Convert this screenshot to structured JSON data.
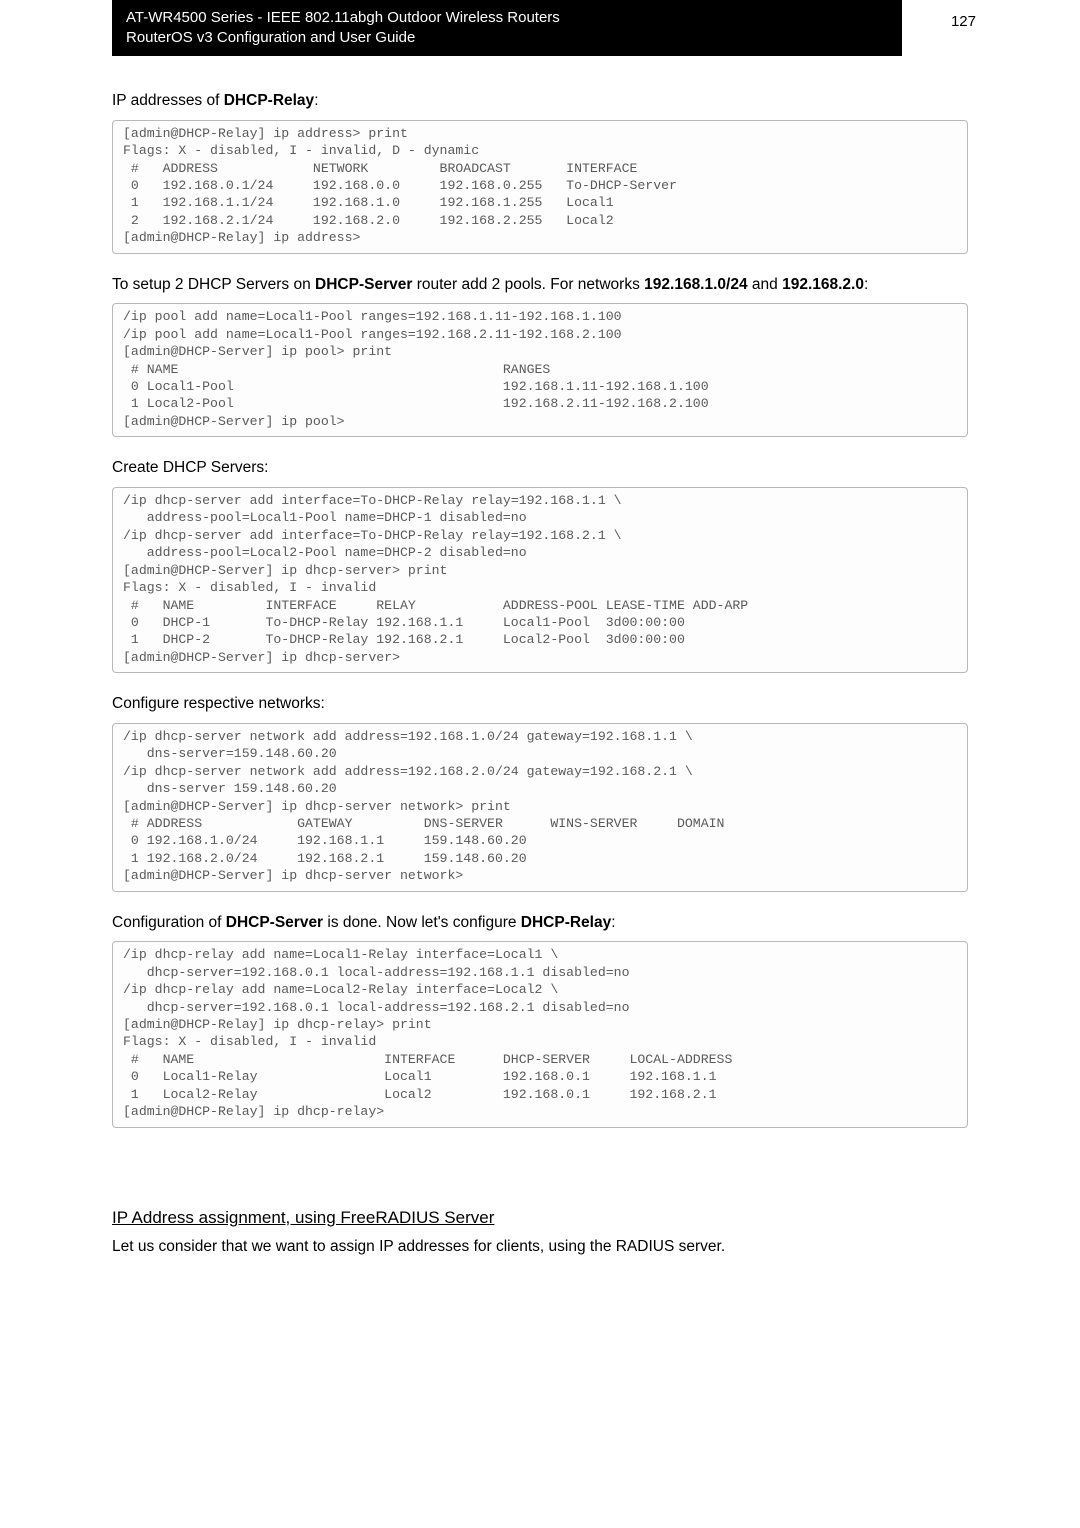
{
  "header": {
    "line1": "AT-WR4500 Series - IEEE 802.11abgh Outdoor Wireless Routers",
    "line2": "RouterOS v3 Configuration and User Guide",
    "page_number": "127"
  },
  "section1": {
    "heading_pre": "IP addresses of ",
    "heading_bold": "DHCP-Relay",
    "heading_post": ":",
    "code": "[admin@DHCP-Relay] ip address> print\nFlags: X - disabled, I - invalid, D - dynamic\n #   ADDRESS            NETWORK         BROADCAST       INTERFACE\n 0   192.168.0.1/24     192.168.0.0     192.168.0.255   To-DHCP-Server\n 1   192.168.1.1/24     192.168.1.0     192.168.1.255   Local1\n 2   192.168.2.1/24     192.168.2.0     192.168.2.255   Local2\n[admin@DHCP-Relay] ip address>"
  },
  "section2": {
    "heading_pre": "To setup 2 DHCP Servers on ",
    "heading_bold1": "DHCP-Server",
    "heading_mid": " router add 2 pools. For networks ",
    "heading_bold2": "192.168.1.0/24",
    "heading_mid2": " and ",
    "heading_bold3": "192.168.2.0",
    "heading_post": ":",
    "code": "/ip pool add name=Local1-Pool ranges=192.168.1.11-192.168.1.100\n/ip pool add name=Local1-Pool ranges=192.168.2.11-192.168.2.100\n[admin@DHCP-Server] ip pool> print\n # NAME                                         RANGES\n 0 Local1-Pool                                  192.168.1.11-192.168.1.100\n 1 Local2-Pool                                  192.168.2.11-192.168.2.100\n[admin@DHCP-Server] ip pool>"
  },
  "section3": {
    "heading": "Create DHCP Servers:",
    "code": "/ip dhcp-server add interface=To-DHCP-Relay relay=192.168.1.1 \\\n   address-pool=Local1-Pool name=DHCP-1 disabled=no\n/ip dhcp-server add interface=To-DHCP-Relay relay=192.168.2.1 \\\n   address-pool=Local2-Pool name=DHCP-2 disabled=no\n[admin@DHCP-Server] ip dhcp-server> print\nFlags: X - disabled, I - invalid\n #   NAME         INTERFACE     RELAY           ADDRESS-POOL LEASE-TIME ADD-ARP\n 0   DHCP-1       To-DHCP-Relay 192.168.1.1     Local1-Pool  3d00:00:00\n 1   DHCP-2       To-DHCP-Relay 192.168.2.1     Local2-Pool  3d00:00:00\n[admin@DHCP-Server] ip dhcp-server>"
  },
  "section4": {
    "heading": "Configure respective networks:",
    "code": "/ip dhcp-server network add address=192.168.1.0/24 gateway=192.168.1.1 \\\n   dns-server=159.148.60.20\n/ip dhcp-server network add address=192.168.2.0/24 gateway=192.168.2.1 \\\n   dns-server 159.148.60.20\n[admin@DHCP-Server] ip dhcp-server network> print\n # ADDRESS            GATEWAY         DNS-SERVER      WINS-SERVER     DOMAIN\n 0 192.168.1.0/24     192.168.1.1     159.148.60.20\n 1 192.168.2.0/24     192.168.2.1     159.148.60.20\n[admin@DHCP-Server] ip dhcp-server network>"
  },
  "section5": {
    "heading_pre": "Configuration of ",
    "heading_bold1": "DHCP-Server",
    "heading_mid": " is done. Now let's configure ",
    "heading_bold2": "DHCP-Relay",
    "heading_post": ":",
    "code": "/ip dhcp-relay add name=Local1-Relay interface=Local1 \\\n   dhcp-server=192.168.0.1 local-address=192.168.1.1 disabled=no\n/ip dhcp-relay add name=Local2-Relay interface=Local2 \\\n   dhcp-server=192.168.0.1 local-address=192.168.2.1 disabled=no\n[admin@DHCP-Relay] ip dhcp-relay> print\nFlags: X - disabled, I - invalid\n #   NAME                        INTERFACE      DHCP-SERVER     LOCAL-ADDRESS\n 0   Local1-Relay                Local1         192.168.0.1     192.168.1.1\n 1   Local2-Relay                Local2         192.168.0.1     192.168.2.1\n[admin@DHCP-Relay] ip dhcp-relay>"
  },
  "section6": {
    "heading": "IP Address assignment, using FreeRADIUS Server",
    "body": "Let us consider that we want to assign IP addresses for clients, using the RADIUS server."
  }
}
